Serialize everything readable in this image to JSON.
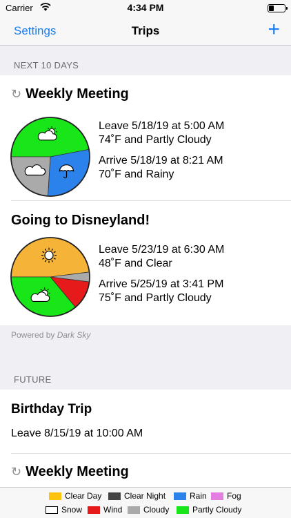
{
  "status_bar": {
    "carrier": "Carrier",
    "time": "4:34 PM"
  },
  "nav": {
    "left_button": "Settings",
    "title": "Trips",
    "add_button": "+"
  },
  "sections": {
    "next": "NEXT 10 DAYS",
    "future": "FUTURE"
  },
  "trips_next": [
    {
      "title": "Weekly Meeting",
      "repeating": true,
      "leave": "Leave 5/18/19 at 5:00 AM",
      "leave_weather": "74˚F and Partly Cloudy",
      "arrive": "Arrive 5/18/19 at 8:21 AM",
      "arrive_weather": "70˚F and Rainy",
      "pie": [
        {
          "condition": "Partly Cloudy",
          "color": "#19e619",
          "fraction": 0.47,
          "icon": "partly-cloudy-icon"
        },
        {
          "condition": "Rain",
          "color": "#2b82ea",
          "fraction": 0.29,
          "icon": "umbrella-icon"
        },
        {
          "condition": "Cloudy",
          "color": "#aaaaaa",
          "fraction": 0.24,
          "icon": "cloud-icon"
        }
      ]
    },
    {
      "title": "Going to Disneyland!",
      "repeating": false,
      "leave": "Leave 5/23/19 at 6:30 AM",
      "leave_weather": "48˚F and Clear",
      "arrive": "Arrive 5/25/19 at 3:41 PM",
      "arrive_weather": "75˚F and Partly Cloudy",
      "pie": [
        {
          "condition": "Clear Day",
          "color": "#f5b337",
          "fraction": 0.48,
          "icon": "sun-icon"
        },
        {
          "condition": "Cloudy",
          "color": "#aaaaaa",
          "fraction": 0.04,
          "icon": ""
        },
        {
          "condition": "Wind",
          "color": "#e61a1a",
          "fraction": 0.12,
          "icon": ""
        },
        {
          "condition": "Partly Cloudy",
          "color": "#19e619",
          "fraction": 0.36,
          "icon": "partly-cloudy-icon"
        }
      ]
    }
  ],
  "powered_by": {
    "prefix": "Powered by",
    "name": "Dark Sky"
  },
  "trips_future": [
    {
      "title": "Birthday Trip",
      "repeating": false,
      "leave": "Leave 8/15/19 at 10:00 AM"
    },
    {
      "title": "Weekly Meeting",
      "repeating": true
    }
  ],
  "repeat_symbol": "↻",
  "legend": [
    {
      "label": "Clear Day",
      "color": "#ffc20e"
    },
    {
      "label": "Clear Night",
      "color": "#444444"
    },
    {
      "label": "Rain",
      "color": "#2b82ea"
    },
    {
      "label": "Fog",
      "color": "#e27fe0"
    },
    {
      "label": "Snow",
      "color": "#ffffff"
    },
    {
      "label": "Wind",
      "color": "#e61a1a"
    },
    {
      "label": "Cloudy",
      "color": "#aaaaaa"
    },
    {
      "label": "Partly Cloudy",
      "color": "#19e619"
    }
  ]
}
